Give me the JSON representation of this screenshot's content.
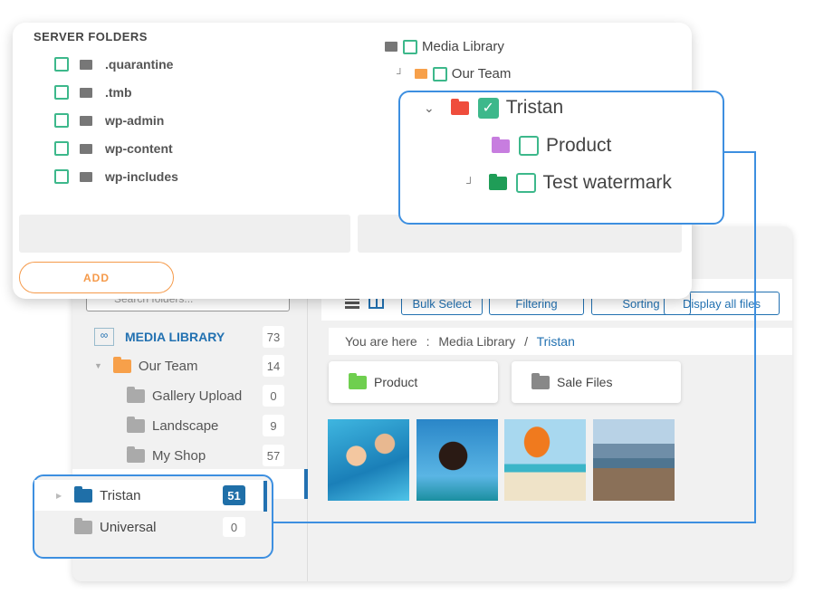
{
  "server_folders": {
    "title": "SERVER FOLDERS",
    "items": [
      ".quarantine",
      ".tmb",
      "wp-admin",
      "wp-content",
      "wp-includes"
    ],
    "add_label": "ADD"
  },
  "media_tree": {
    "root": "Media Library",
    "child": "Our Team",
    "selected": "Tristan",
    "subfolders": [
      "Product",
      "Test watermark"
    ]
  },
  "sidebar": {
    "search_placeholder": "Search folders...",
    "library": {
      "label": "MEDIA LIBRARY",
      "count": "73"
    },
    "items": [
      {
        "label": "Our Team",
        "count": "14"
      },
      {
        "label": "Gallery Upload",
        "count": "0"
      },
      {
        "label": "Landscape",
        "count": "9"
      },
      {
        "label": "My Shop",
        "count": "57"
      },
      {
        "label": "Tristan",
        "count": "51"
      },
      {
        "label": "Universal",
        "count": "0"
      }
    ]
  },
  "toolbar": {
    "bulk_select": "Bulk Select",
    "filtering": "Filtering",
    "sorting": "Sorting",
    "display_all": "Display all files"
  },
  "breadcrumb": {
    "prefix": "You are here",
    "sep1": ":",
    "root": "Media Library",
    "sep2": "/",
    "current": "Tristan"
  },
  "folder_cards": [
    "Product",
    "Sale Files"
  ],
  "colors": {
    "accent": "#2271b1",
    "callout": "#3d8fe0",
    "green": "#3db88b",
    "orange": "#f59a4a",
    "red": "#ef4d3c",
    "purple": "#c77ddf"
  }
}
